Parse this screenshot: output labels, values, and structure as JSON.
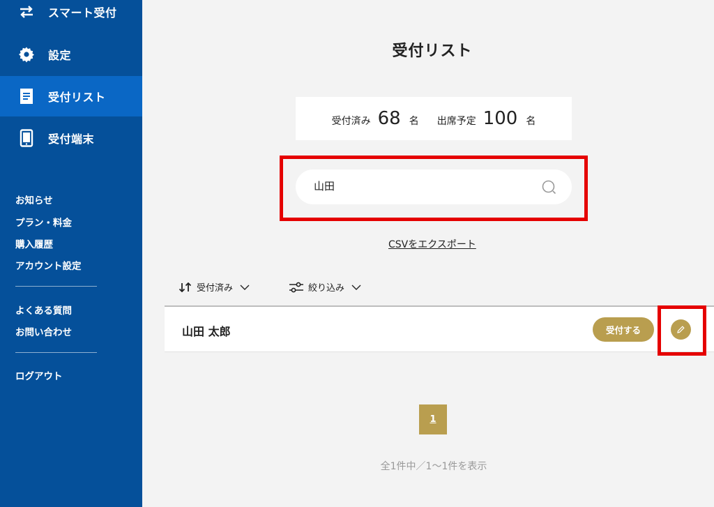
{
  "sidebar": {
    "nav": [
      {
        "label": "スマート受付",
        "icon": "swap-arrows-icon"
      },
      {
        "label": "設定",
        "icon": "gear-icon"
      },
      {
        "label": "受付リスト",
        "icon": "document-icon"
      },
      {
        "label": "受付端末",
        "icon": "tablet-icon"
      }
    ],
    "active_index": 2,
    "links_group1": [
      "お知らせ",
      "プラン・料金",
      "購入履歴",
      "アカウント設定"
    ],
    "links_group2": [
      "よくある質問",
      "お問い合わせ"
    ],
    "logout": "ログアウト"
  },
  "main": {
    "title": "受付リスト",
    "stats": {
      "checked_in_label": "受付済み",
      "checked_in_value": "68",
      "checked_in_unit": "名",
      "expected_label": "出席予定",
      "expected_value": "100",
      "expected_unit": "名"
    },
    "search": {
      "value": "山田",
      "placeholder": ""
    },
    "csv_export": "CSVをエクスポート",
    "sort_label": "受付済み",
    "filter_label": "絞り込み",
    "rows": [
      {
        "name": "山田 太郎",
        "action": "受付する"
      }
    ],
    "pagination": {
      "current_page": "1",
      "info": "全1件中／1〜1件を表示"
    }
  },
  "colors": {
    "sidebar": "#05509a",
    "sidebar_active": "#0a67c5",
    "accent_gold": "#b99e4f",
    "highlight_red": "#e50000",
    "background": "#f3f3f3"
  }
}
